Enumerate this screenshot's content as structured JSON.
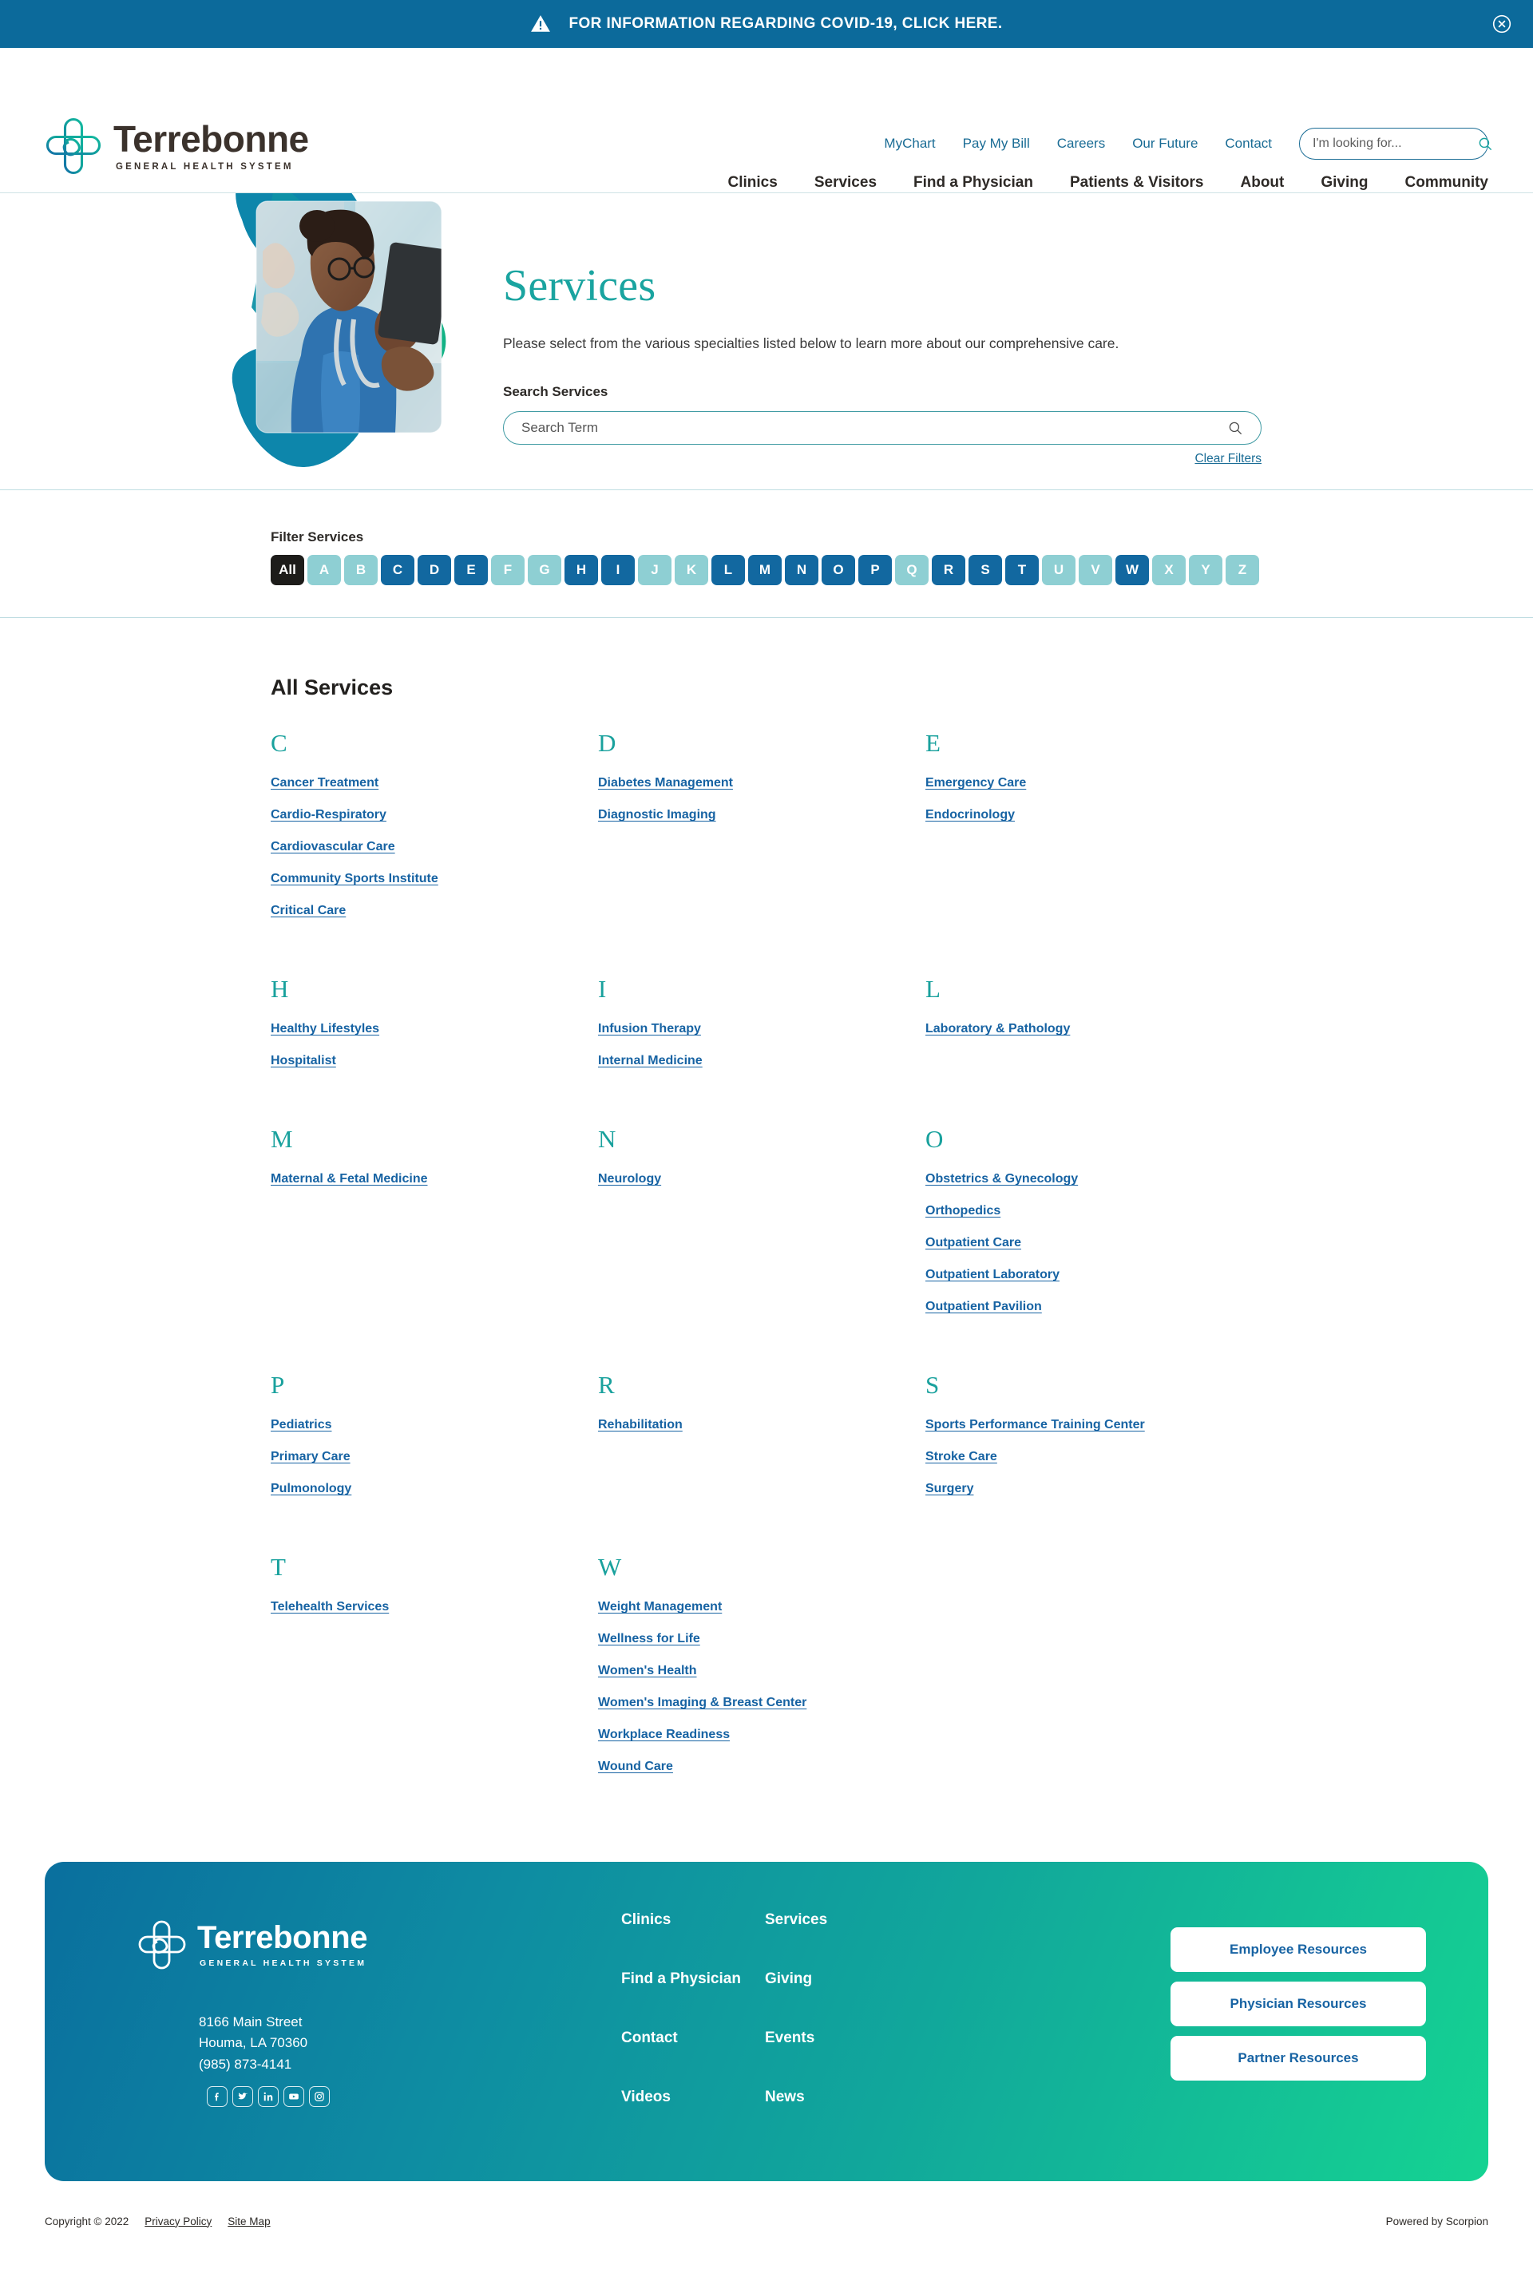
{
  "alert": {
    "text": "FOR INFORMATION REGARDING COVID-19, CLICK HERE.",
    "icon": "warning-triangle-icon",
    "close_icon": "close-circle-icon",
    "bg_color": "#0c6a9b"
  },
  "brand": {
    "name": "Terrebonne",
    "tagline": "GENERAL HEALTH SYSTEM",
    "logo_icon": "terrebonne-cross-logo"
  },
  "header": {
    "utility_links": [
      "MyChart",
      "Pay My Bill",
      "Careers",
      "Our Future",
      "Contact"
    ],
    "search": {
      "placeholder": "I'm looking for...",
      "value": "",
      "icon": "search-icon"
    },
    "main_nav": [
      "Clinics",
      "Services",
      "Find a Physician",
      "Patients & Visitors",
      "About",
      "Giving",
      "Community"
    ]
  },
  "hero": {
    "title": "Services",
    "subtitle": "Please select from the various specialties listed below to learn more about our comprehensive care.",
    "search_label": "Search Services",
    "search": {
      "placeholder": "Search Term",
      "value": "",
      "icon": "search-icon"
    },
    "clear_filters": "Clear Filters",
    "image_alt": "nurse-with-tablet-photo",
    "accent_teal": "#1aa4a0",
    "accent_blue": "#0e88ab"
  },
  "filter": {
    "label": "Filter Services",
    "all_label": "All",
    "all_active": true,
    "colors": {
      "all": "#1d1c1a",
      "enabled": "#1268a0",
      "disabled": "#8ecfd3"
    },
    "letters": [
      {
        "letter": "A",
        "enabled": false
      },
      {
        "letter": "B",
        "enabled": false
      },
      {
        "letter": "C",
        "enabled": true
      },
      {
        "letter": "D",
        "enabled": true
      },
      {
        "letter": "E",
        "enabled": true
      },
      {
        "letter": "F",
        "enabled": false
      },
      {
        "letter": "G",
        "enabled": false
      },
      {
        "letter": "H",
        "enabled": true
      },
      {
        "letter": "I",
        "enabled": true
      },
      {
        "letter": "J",
        "enabled": false
      },
      {
        "letter": "K",
        "enabled": false
      },
      {
        "letter": "L",
        "enabled": true
      },
      {
        "letter": "M",
        "enabled": true
      },
      {
        "letter": "N",
        "enabled": true
      },
      {
        "letter": "O",
        "enabled": true
      },
      {
        "letter": "P",
        "enabled": true
      },
      {
        "letter": "Q",
        "enabled": false
      },
      {
        "letter": "R",
        "enabled": true
      },
      {
        "letter": "S",
        "enabled": true
      },
      {
        "letter": "T",
        "enabled": true
      },
      {
        "letter": "U",
        "enabled": false
      },
      {
        "letter": "V",
        "enabled": false
      },
      {
        "letter": "W",
        "enabled": true
      },
      {
        "letter": "X",
        "enabled": false
      },
      {
        "letter": "Y",
        "enabled": false
      },
      {
        "letter": "Z",
        "enabled": false
      }
    ]
  },
  "services": {
    "heading": "All Services",
    "groups": [
      {
        "letter": "C",
        "items": [
          "Cancer Treatment",
          "Cardio-Respiratory",
          "Cardiovascular Care",
          "Community Sports Institute",
          "Critical Care"
        ]
      },
      {
        "letter": "D",
        "items": [
          "Diabetes Management",
          "Diagnostic Imaging"
        ]
      },
      {
        "letter": "E",
        "items": [
          "Emergency Care",
          "Endocrinology"
        ]
      },
      {
        "letter": "H",
        "items": [
          "Healthy Lifestyles",
          "Hospitalist"
        ]
      },
      {
        "letter": "I",
        "items": [
          "Infusion Therapy",
          "Internal Medicine"
        ]
      },
      {
        "letter": "L",
        "items": [
          "Laboratory & Pathology"
        ]
      },
      {
        "letter": "M",
        "items": [
          "Maternal & Fetal Medicine"
        ]
      },
      {
        "letter": "N",
        "items": [
          "Neurology"
        ]
      },
      {
        "letter": "O",
        "items": [
          "Obstetrics & Gynecology",
          "Orthopedics",
          "Outpatient Care",
          "Outpatient Laboratory",
          "Outpatient Pavilion"
        ]
      },
      {
        "letter": "P",
        "items": [
          "Pediatrics",
          "Primary Care",
          "Pulmonology"
        ]
      },
      {
        "letter": "R",
        "items": [
          "Rehabilitation"
        ]
      },
      {
        "letter": "S",
        "items": [
          "Sports Performance Training Center",
          "Stroke Care",
          "Surgery"
        ]
      },
      {
        "letter": "T",
        "items": [
          "Telehealth Services"
        ]
      },
      {
        "letter": "W",
        "items": [
          "Weight Management",
          "Wellness for Life",
          "Women's Health",
          "Women's Imaging & Breast Center",
          "Workplace Readiness",
          "Wound Care"
        ]
      }
    ]
  },
  "footer": {
    "address": [
      "8166 Main Street",
      "Houma, LA 70360",
      "(985) 873-4141"
    ],
    "social": [
      "facebook-icon",
      "twitter-icon",
      "linkedin-icon",
      "youtube-icon",
      "instagram-icon"
    ],
    "nav": [
      "Clinics",
      "Services",
      "Find a Physician",
      "Giving",
      "Contact",
      "Events",
      "Videos",
      "News"
    ],
    "buttons": [
      "Employee Resources",
      "Physician Resources",
      "Partner Resources"
    ],
    "gradient_from": "#0a6f9e",
    "gradient_to": "#15d392"
  },
  "bottom": {
    "copyright": "Copyright © 2022",
    "links": [
      "Privacy Policy",
      "Site Map"
    ],
    "powered_by": "Powered by Scorpion"
  }
}
